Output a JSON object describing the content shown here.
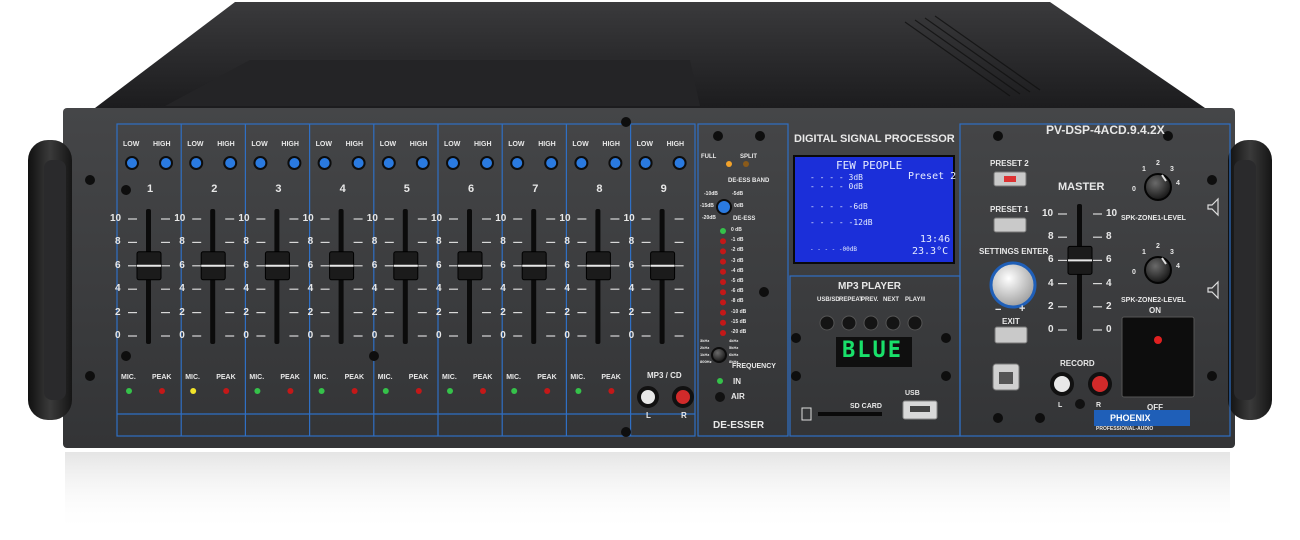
{
  "device": {
    "model": "PV-DSP-4ACD.9.4.2X",
    "brand": "PHOENIX",
    "brand_sub": "PROFESSIONAL-AUDIO"
  },
  "channels": [
    {
      "number": "1",
      "eq_low": "LOW",
      "eq_high": "HIGH",
      "mic_label": "MIC.",
      "peak_label": "PEAK",
      "level": 6
    },
    {
      "number": "2",
      "eq_low": "LOW",
      "eq_high": "HIGH",
      "mic_label": "MIC.",
      "peak_label": "PEAK",
      "level": 6
    },
    {
      "number": "3",
      "eq_low": "LOW",
      "eq_high": "HIGH",
      "mic_label": "MIC.",
      "peak_label": "PEAK",
      "level": 6
    },
    {
      "number": "4",
      "eq_low": "LOW",
      "eq_high": "HIGH",
      "mic_label": "MIC.",
      "peak_label": "PEAK",
      "level": 6
    },
    {
      "number": "5",
      "eq_low": "LOW",
      "eq_high": "HIGH",
      "mic_label": "MIC.",
      "peak_label": "PEAK",
      "level": 6
    },
    {
      "number": "6",
      "eq_low": "LOW",
      "eq_high": "HIGH",
      "mic_label": "MIC.",
      "peak_label": "PEAK",
      "level": 6
    },
    {
      "number": "7",
      "eq_low": "LOW",
      "eq_high": "HIGH",
      "mic_label": "MIC.",
      "peak_label": "PEAK",
      "level": 6
    },
    {
      "number": "8",
      "eq_low": "LOW",
      "eq_high": "HIGH",
      "mic_label": "MIC.",
      "peak_label": "PEAK",
      "level": 6
    },
    {
      "number": "9",
      "eq_low": "LOW",
      "eq_high": "HIGH",
      "level": 6
    }
  ],
  "fader_scale": [
    "10",
    "8",
    "6",
    "4",
    "2",
    "0"
  ],
  "mp3_cd_input": {
    "label": "MP3 / CD",
    "left": "L",
    "right": "R"
  },
  "de_esser": {
    "title": "DE-ESSER",
    "full": "FULL",
    "split": "SPLIT",
    "band": "DE-ESS BAND",
    "knob_label": "DE-ESS",
    "knob_marks": [
      "-10dB",
      "-5dB",
      "-15dB",
      "0dB",
      "-20dB"
    ],
    "meter": [
      "0 dB",
      "-1 dB",
      "-2 dB",
      "-3 dB",
      "-4 dB",
      "-5 dB",
      "-6 dB",
      "-8 dB",
      "-10 dB",
      "-15 dB",
      "-20 dB"
    ],
    "frequency_label": "FREQUENCY",
    "freq_marks": [
      "3kHz",
      "4kHz",
      "2kHz",
      "5kHz",
      "1kHz",
      "6kHz",
      "800Hz",
      "8kHz"
    ],
    "in_label": "IN",
    "air_label": "AIR"
  },
  "dsp": {
    "title": "DIGITAL SIGNAL PROCESSOR",
    "screen": {
      "heading": "FEW  PEOPLE",
      "preset": "Preset 2",
      "rows": [
        "- - - - 3dB",
        "- - - - 0dB",
        "- - - - -6dB",
        "- - - - -12dB",
        "- - - - -00dB"
      ],
      "time": "13:46",
      "temp": "23.3°C"
    }
  },
  "mp3_player": {
    "title": "MP3 PLAYER",
    "buttons": [
      "USB/SD",
      "REPEAT",
      "PREV.",
      "NEXT",
      "PLAY/‖"
    ],
    "display": "BLUE",
    "sd_label": "SD CARD",
    "usb_label": "USB"
  },
  "presets": {
    "preset2": "PRESET 2",
    "preset1": "PRESET 1"
  },
  "settings": {
    "label": "SETTINGS ENTER",
    "minus": "−",
    "plus": "+",
    "exit": "EXIT"
  },
  "master": {
    "title": "MASTER",
    "scale": [
      "10",
      "8",
      "6",
      "4",
      "2",
      "0"
    ],
    "level": 6,
    "zone1_label": "SPK-ZONE1-LEVEL",
    "zone2_label": "SPK-ZONE2-LEVEL",
    "zone_marks": [
      "0",
      "1",
      "2",
      "3",
      "4"
    ]
  },
  "record": {
    "label": "RECORD",
    "left": "L",
    "right": "R"
  },
  "power": {
    "on": "ON",
    "off": "OFF"
  },
  "colors": {
    "panel": "#3a3b3d",
    "accent_blue": "#1c6fd6",
    "lcd": "#1b2fd9",
    "led_green": "#35c24a",
    "led_red": "#c41818",
    "led_amber": "#f2a22a"
  }
}
